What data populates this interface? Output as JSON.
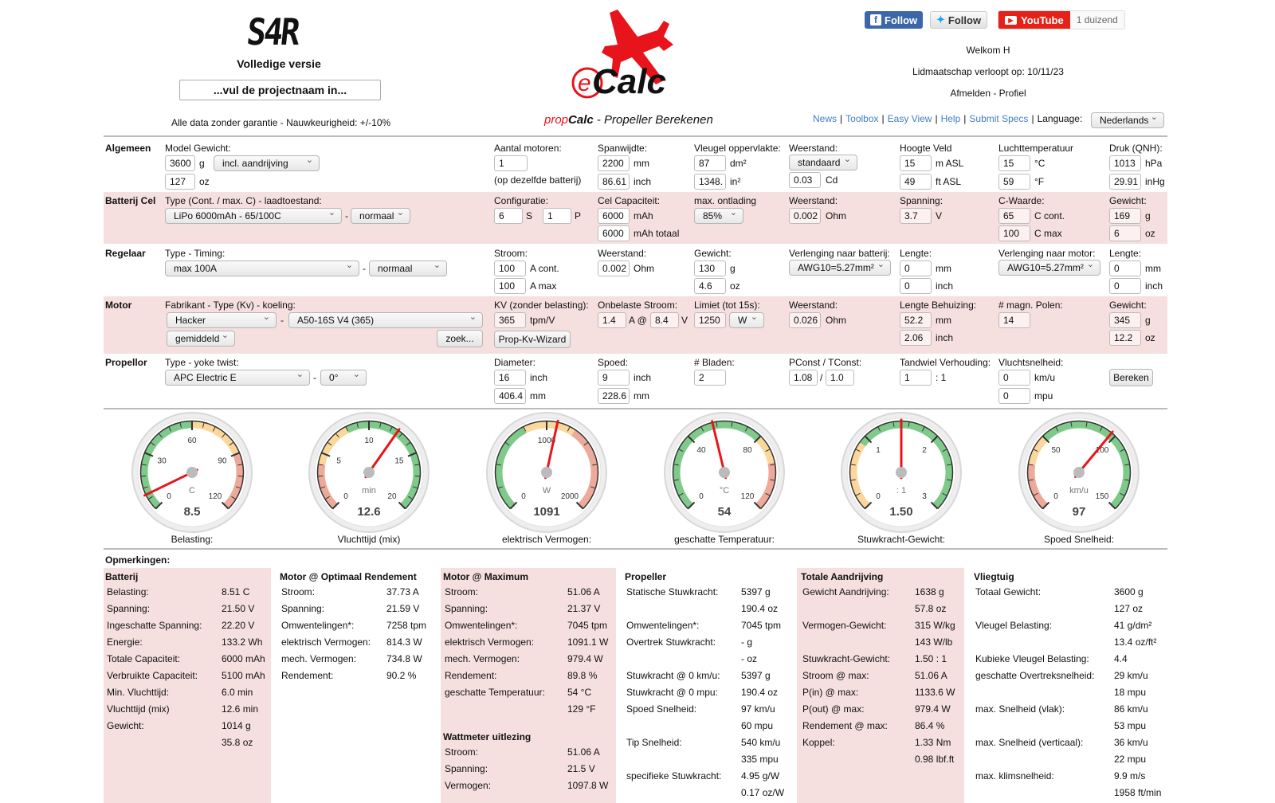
{
  "header": {
    "lcd_code": "S4R",
    "version": "Volledige versie",
    "project_placeholder": "...vul de projectnaam in...",
    "disclaimer": "Alle data zonder garantie - Nauwkeurigheid: +/-10%",
    "logo_text": "Calc",
    "subtitle_prefix": "prop",
    "subtitle_bold": "Calc",
    "subtitle_rest": " - Propeller Berekenen",
    "facebook": "Follow",
    "twitter": "Follow",
    "youtube": "YouTube",
    "youtube_count": "1 duizend",
    "welcome": "Welkom H",
    "membership": "Lidmaatschap verloopt op: 10/11/23",
    "logout_profile": "Afmelden - Profiel",
    "nav": [
      "News",
      "Toolbox",
      "Easy View",
      "Help",
      "Submit Specs"
    ],
    "language_label": "Language:",
    "language": "Nederlands"
  },
  "colors": {
    "accent": "#e8141b",
    "band": "#f5dfdf",
    "link": "#3f7fc7"
  },
  "algemeen": {
    "title": "Algemeen",
    "model_weight_label": "Model Gewicht:",
    "weight_g": "3600",
    "weight_g_unit": "g",
    "weight_mode": "incl. aandrijving",
    "weight_oz": "127",
    "weight_oz_unit": "oz",
    "motors_label": "Aantal motoren:",
    "motors": "1",
    "motors_note": "(op dezelfde batterij)",
    "span_label": "Spanwijdte:",
    "span_mm": "2200",
    "span_mm_unit": "mm",
    "span_inch": "86.61",
    "span_inch_unit": "inch",
    "wing_label": "Vleugel oppervlakte:",
    "wing_dm2": "87",
    "wing_dm2_unit": "dm²",
    "wing_in2": "1348.",
    "wing_in2_unit": "in²",
    "drag_label": "Weerstand:",
    "drag_mode": "standaard",
    "drag_cd": "0.03",
    "drag_cd_unit": "Cd",
    "alt_label": "Hoogte Veld",
    "alt_m": "15",
    "alt_m_unit": "m ASL",
    "alt_ft": "49",
    "alt_ft_unit": "ft ASL",
    "temp_label": "Luchttemperatuur",
    "temp_c": "15",
    "temp_c_unit": "°C",
    "temp_f": "59",
    "temp_f_unit": "°F",
    "press_label": "Druk (QNH):",
    "press_hpa": "1013",
    "press_hpa_unit": "hPa",
    "press_inhg": "29.91",
    "press_inhg_unit": "inHg"
  },
  "batterij": {
    "title": "Batterij Cel",
    "type_label": "Type (Cont. / max. C) - laadtoestand:",
    "type": "LiPo 6000mAh - 65/100C",
    "state": "normaal",
    "config_label": "Configuratie:",
    "s": "6",
    "s_unit": "S",
    "p": "1",
    "p_unit": "P",
    "cap_label": "Cel Capaciteit:",
    "cap": "6000",
    "cap_unit": "mAh",
    "cap_total": "6000",
    "cap_total_unit": "mAh totaal",
    "discharge_label": "max. ontlading",
    "discharge": "85%",
    "res_label": "Weerstand:",
    "res": "0.002",
    "res_unit": "Ohm",
    "volt_label": "Spanning:",
    "volt": "3.7",
    "volt_unit": "V",
    "c_label": "C-Waarde:",
    "c_cont": "65",
    "c_cont_unit": "C cont.",
    "c_max": "100",
    "c_max_unit": "C max",
    "weight_label": "Gewicht:",
    "weight_g": "169",
    "weight_g_unit": "g",
    "weight_oz": "6",
    "weight_oz_unit": "oz"
  },
  "regelaar": {
    "title": "Regelaar",
    "type_label": "Type - Timing:",
    "type": "max 100A",
    "timing": "normaal",
    "current_label": "Stroom:",
    "cont": "100",
    "cont_unit": "A cont.",
    "max": "100",
    "max_unit": "A max",
    "res_label": "Weerstand:",
    "res": "0.002",
    "res_unit": "Ohm",
    "weight_label": "Gewicht:",
    "weight_g": "130",
    "weight_g_unit": "g",
    "weight_oz": "4.6",
    "weight_oz_unit": "oz",
    "ext_batt_label": "Verlenging naar batterij:",
    "ext_batt": "AWG10=5.27mm²",
    "len1_label": "Lengte:",
    "len1_mm": "0",
    "len1_mm_unit": "mm",
    "len1_inch": "0",
    "len1_inch_unit": "inch",
    "ext_motor_label": "Verlenging naar motor:",
    "ext_motor": "AWG10=5.27mm²",
    "len2_label": "Lengte:",
    "len2_mm": "0",
    "len2_mm_unit": "mm",
    "len2_inch": "0",
    "len2_inch_unit": "inch"
  },
  "motor": {
    "title": "Motor",
    "type_label": "Fabrikant - Type (Kv) - koeling:",
    "maker": "Hacker",
    "model": "A50-16S V4 (365)",
    "cooling": "gemiddeld",
    "search": "zoek...",
    "kv_label": "KV (zonder belasting):",
    "kv": "365",
    "kv_unit": "tpm/V",
    "wizard": "Prop-Kv-Wizard",
    "noload_label": "Onbelaste Stroom:",
    "noload_a": "1.4",
    "noload_a_unit": "A @",
    "noload_v": "8.4",
    "noload_v_unit": "V",
    "limit_label": "Limiet (tot 15s):",
    "limit": "1250",
    "limit_unit": "W",
    "res_label": "Weerstand:",
    "res": "0.026",
    "res_unit": "Ohm",
    "len_label": "Lengte Behuizing:",
    "len_mm": "52.2",
    "len_mm_unit": "mm",
    "len_inch": "2.06",
    "len_inch_unit": "inch",
    "poles_label": "# magn. Polen:",
    "poles": "14",
    "weight_label": "Gewicht:",
    "weight_g": "345",
    "weight_g_unit": "g",
    "weight_oz": "12.2",
    "weight_oz_unit": "oz"
  },
  "propellor": {
    "title": "Propellor",
    "type_label": "Type - yoke twist:",
    "type": "APC Electric E",
    "twist": "0°",
    "dia_label": "Diameter:",
    "dia_inch": "16",
    "dia_inch_unit": "inch",
    "dia_mm": "406.4",
    "dia_mm_unit": "mm",
    "pitch_label": "Spoed:",
    "pitch_inch": "9",
    "pitch_inch_unit": "inch",
    "pitch_mm": "228.6",
    "pitch_mm_unit": "mm",
    "blades_label": "# Bladen:",
    "blades": "2",
    "pconst_label": "PConst / TConst:",
    "pconst": "1.08",
    "sep": "/",
    "tconst": "1.0",
    "gear_label": "Tandwiel Verhouding:",
    "gear": "1",
    "gear_unit": ": 1",
    "speed_label": "Vluchtsnelheid:",
    "speed_kmh": "0",
    "speed_kmh_unit": "km/u",
    "speed_mph": "0",
    "speed_mph_unit": "mpu",
    "calc": "Bereken"
  },
  "gauges": [
    {
      "label": "Belasting:",
      "unit": "C",
      "value": 8.5,
      "display": "8.5",
      "min": 0,
      "max": 120,
      "ticks": [
        "0",
        "30",
        "60",
        "90",
        "120"
      ],
      "zones": [
        [
          "g",
          0,
          60
        ],
        [
          "y",
          60,
          90
        ],
        [
          "r",
          90,
          120
        ]
      ]
    },
    {
      "label": "Vluchttijd (mix)",
      "unit": "min",
      "value": 12.6,
      "display": "12.6",
      "min": 0,
      "max": 20,
      "ticks": [
        "0",
        "5",
        "10",
        "15",
        "20"
      ],
      "zones": [
        [
          "r",
          0,
          4
        ],
        [
          "y",
          4,
          8
        ],
        [
          "g",
          8,
          20
        ]
      ]
    },
    {
      "label": "elektrisch Vermogen:",
      "unit": "W",
      "value": 1091,
      "display": "1091",
      "min": 0,
      "max": 2000,
      "ticks": [
        "0",
        "1000",
        "2000"
      ],
      "zones": [
        [
          "g",
          0,
          800
        ],
        [
          "y",
          800,
          1250
        ],
        [
          "r",
          1250,
          2000
        ]
      ]
    },
    {
      "label": "geschatte Temperatuur:",
      "unit": "°C",
      "value": 54,
      "display": "54",
      "min": 0,
      "max": 120,
      "ticks": [
        "0",
        "40",
        "80",
        "120"
      ],
      "zones": [
        [
          "g",
          0,
          80
        ],
        [
          "y",
          80,
          95
        ],
        [
          "r",
          95,
          120
        ]
      ]
    },
    {
      "label": "Stuwkracht-Gewicht:",
      "unit": ": 1",
      "value": 1.5,
      "display": "1.50",
      "min": 0,
      "max": 3,
      "ticks": [
        "0",
        "1",
        "2",
        "3"
      ],
      "zones": [
        [
          "r",
          0,
          0.5
        ],
        [
          "y",
          0,
          0.9
        ],
        [
          "g",
          0.9,
          3
        ]
      ]
    },
    {
      "label": "Spoed Snelheid:",
      "unit": "km/u",
      "value": 97,
      "display": "97",
      "min": 0,
      "max": 150,
      "ticks": [
        "0",
        "50",
        "100",
        "150"
      ],
      "zones": [
        [
          "r",
          0,
          30
        ],
        [
          "y",
          30,
          50
        ],
        [
          "g",
          50,
          150
        ]
      ]
    }
  ],
  "results": {
    "remarks": "Opmerkingen:",
    "columns": [
      {
        "title": "Batterij",
        "rows": [
          [
            "Belasting:",
            "8.51 C"
          ],
          [
            "Spanning:",
            "21.50 V"
          ],
          [
            "Ingeschatte Spanning:",
            "22.20 V"
          ],
          [
            "Energie:",
            "133.2 Wh"
          ],
          [
            "Totale Capaciteit:",
            "6000 mAh"
          ],
          [
            "Verbruikte Capaciteit:",
            "5100 mAh"
          ],
          [
            "Min. Vluchttijd:",
            "6.0 min"
          ],
          [
            "Vluchttijd (mix)",
            "12.6 min"
          ],
          [
            "Gewicht:",
            "1014 g"
          ],
          [
            "",
            "35.8 oz"
          ]
        ]
      },
      {
        "title": "Motor @ Optimaal Rendement",
        "rows": [
          [
            "Stroom:",
            "37.73 A"
          ],
          [
            "Spanning:",
            "21.59 V"
          ],
          [
            "Omwentelingen*:",
            "7258 tpm"
          ],
          [
            "elektrisch Vermogen:",
            "814.3 W"
          ],
          [
            "mech. Vermogen:",
            "734.8 W"
          ],
          [
            "Rendement:",
            "90.2 %"
          ]
        ]
      },
      {
        "title": "Motor @ Maximum",
        "rows": [
          [
            "Stroom:",
            "51.06 A"
          ],
          [
            "Spanning:",
            "21.37 V"
          ],
          [
            "Omwentelingen*:",
            "7045 tpm"
          ],
          [
            "elektrisch Vermogen:",
            "1091.1 W"
          ],
          [
            "mech. Vermogen:",
            "979.4 W"
          ],
          [
            "Rendement:",
            "89.8 %"
          ],
          [
            "geschatte Temperatuur:",
            "54 °C"
          ],
          [
            "",
            "129 °F"
          ]
        ],
        "sub_title": "Wattmeter uitlezing",
        "sub_rows": [
          [
            "Stroom:",
            "51.06 A"
          ],
          [
            "Spanning:",
            "21.5 V"
          ],
          [
            "Vermogen:",
            "1097.8 W"
          ]
        ]
      },
      {
        "title": "Propeller",
        "rows": [
          [
            "Statische Stuwkracht:",
            "5397 g"
          ],
          [
            "",
            "190.4 oz"
          ],
          [
            "Omwentelingen*:",
            "7045 tpm"
          ],
          [
            "Overtrek Stuwkracht:",
            "- g"
          ],
          [
            "",
            "- oz"
          ],
          [
            "Stuwkracht @ 0 km/u:",
            "5397 g"
          ],
          [
            "Stuwkracht @ 0 mpu:",
            "190.4 oz"
          ],
          [
            "Spoed Snelheid:",
            "97 km/u"
          ],
          [
            "",
            "60 mpu"
          ],
          [
            "Tip Snelheid:",
            "540 km/u"
          ],
          [
            "",
            "335 mpu"
          ],
          [
            "specifieke Stuwkracht:",
            "4.95 g/W"
          ],
          [
            "",
            "0.17 oz/W"
          ]
        ]
      },
      {
        "title": "Totale Aandrijving",
        "rows": [
          [
            "Gewicht Aandrijving:",
            "1638 g"
          ],
          [
            "",
            "57.8 oz"
          ],
          [
            "Vermogen-Gewicht:",
            "315 W/kg"
          ],
          [
            "",
            "143 W/lb"
          ],
          [
            "Stuwkracht-Gewicht:",
            "1.50 : 1"
          ],
          [
            "Stroom @ max:",
            "51.06 A"
          ],
          [
            "P(in) @ max:",
            "1133.6 W"
          ],
          [
            "P(out) @ max:",
            "979.4 W"
          ],
          [
            "Rendement @ max:",
            "86.4 %"
          ],
          [
            "Koppel:",
            "1.33 Nm"
          ],
          [
            "",
            "0.98 lbf.ft"
          ]
        ]
      },
      {
        "title": "Vliegtuig",
        "rows": [
          [
            "Totaal Gewicht:",
            "3600 g"
          ],
          [
            "",
            "127 oz"
          ],
          [
            "Vleugel Belasting:",
            "41 g/dm²"
          ],
          [
            "",
            "13.4 oz/ft²"
          ],
          [
            "Kubieke Vleugel Belasting:",
            "4.4"
          ],
          [
            "geschatte Overtreksnelheid:",
            "29 km/u"
          ],
          [
            "",
            "18 mpu"
          ],
          [
            "max. Snelheid (vlak):",
            "86 km/u"
          ],
          [
            "",
            "53 mpu"
          ],
          [
            "max. Snelheid (verticaal):",
            "36 km/u"
          ],
          [
            "",
            "22 mpu"
          ],
          [
            "max. klimsnelheid:",
            "9.9 m/s"
          ],
          [
            "",
            "1958 ft/min"
          ]
        ]
      }
    ]
  }
}
